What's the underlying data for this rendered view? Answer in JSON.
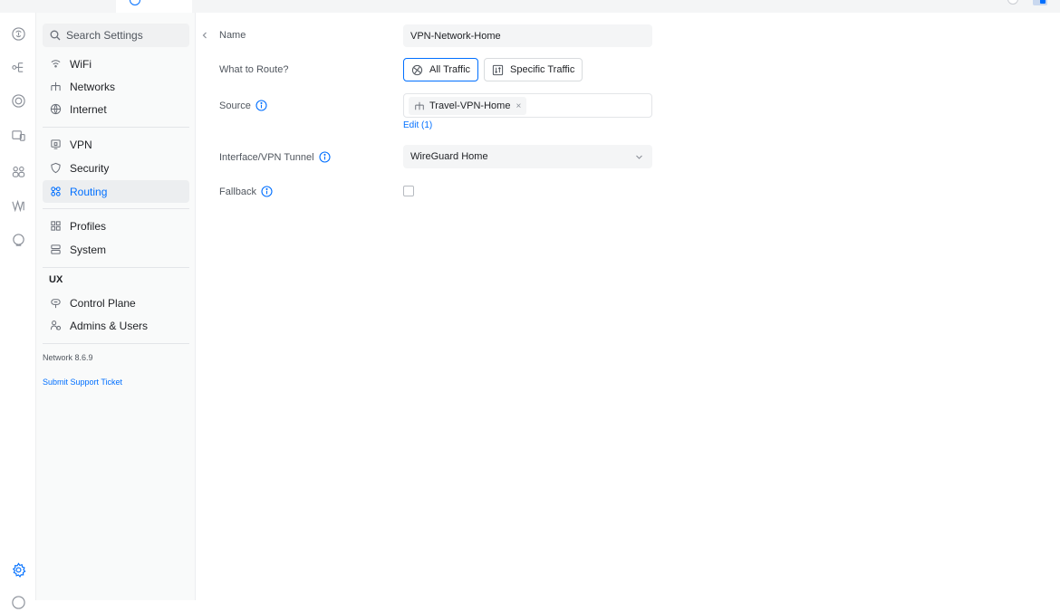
{
  "sidebar": {
    "search_placeholder": "Search Settings",
    "items": [
      {
        "label": "WiFi",
        "icon": "wifi-icon"
      },
      {
        "label": "Networks",
        "icon": "network-tree-icon"
      },
      {
        "label": "Internet",
        "icon": "globe-icon"
      },
      {
        "label": "VPN",
        "icon": "vpn-monitor-icon"
      },
      {
        "label": "Security",
        "icon": "shield-icon"
      },
      {
        "label": "Routing",
        "icon": "routing-icon",
        "active": true
      },
      {
        "label": "Profiles",
        "icon": "profiles-icon"
      },
      {
        "label": "System",
        "icon": "system-icon"
      }
    ],
    "ux_section": {
      "label": "UX",
      "items": [
        {
          "label": "Control Plane",
          "icon": "control-plane-icon"
        },
        {
          "label": "Admins & Users",
          "icon": "admins-users-icon"
        }
      ]
    },
    "version": "Network 8.6.9",
    "support_link": "Submit Support Ticket"
  },
  "form": {
    "name": {
      "label": "Name",
      "value": "VPN-Network-Home"
    },
    "what_to_route": {
      "label": "What to Route?",
      "options": [
        {
          "label": "All Traffic",
          "selected": true
        },
        {
          "label": "Specific Traffic",
          "selected": false
        }
      ]
    },
    "source": {
      "label": "Source",
      "chip": "Travel-VPN-Home",
      "chip_remove": "×",
      "edit_link": "Edit (1)"
    },
    "interface": {
      "label": "Interface/VPN Tunnel",
      "value": "WireGuard Home"
    },
    "fallback": {
      "label": "Fallback",
      "checked": false
    }
  },
  "colors": {
    "accent": "#006fff",
    "text": "#212327",
    "muted": "#50565e",
    "field_bg": "#f4f5f6"
  }
}
